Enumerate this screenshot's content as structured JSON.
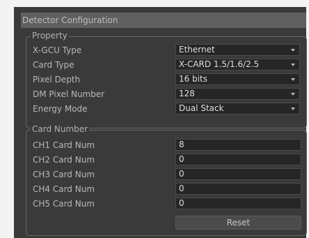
{
  "window": {
    "title": "Detector Configuration"
  },
  "property": {
    "title": "Property",
    "rows": [
      {
        "label": "X-GCU Type",
        "value": "Ethernet"
      },
      {
        "label": "Card Type",
        "value": "X-CARD 1.5/1.6/2.5"
      },
      {
        "label": "Pixel Depth",
        "value": "16 bits"
      },
      {
        "label": "DM Pixel Number",
        "value": "128"
      },
      {
        "label": "Energy Mode",
        "value": "Dual Stack"
      }
    ]
  },
  "card_number": {
    "title": "Card Number",
    "rows": [
      {
        "label": "CH1 Card Num",
        "value": "8"
      },
      {
        "label": "CH2 Card Num",
        "value": "0"
      },
      {
        "label": "CH3 Card Num",
        "value": "0"
      },
      {
        "label": "CH4 Card Num",
        "value": "0"
      },
      {
        "label": "CH5 Card Num",
        "value": "0"
      }
    ],
    "reset_label": "Reset"
  }
}
